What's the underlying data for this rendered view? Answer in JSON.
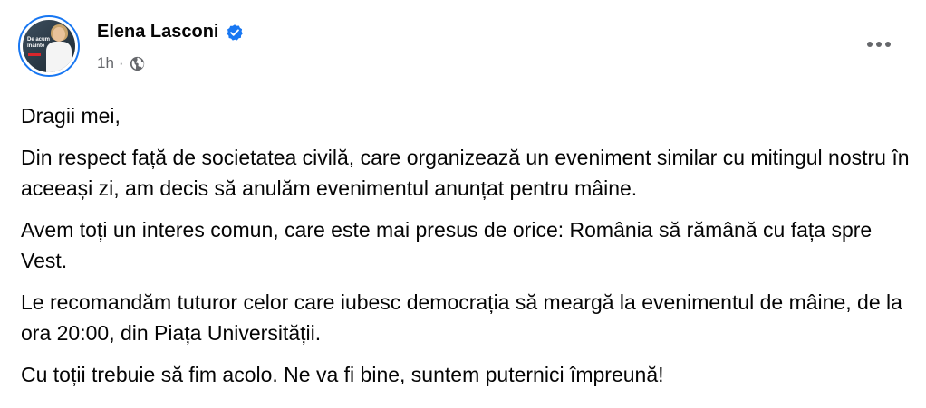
{
  "post": {
    "author": {
      "name": "Elena Lasconi",
      "verified": true,
      "avatar_caption": "De acum înainte"
    },
    "meta": {
      "time": "1h",
      "separator": "·",
      "audience_icon": "globe-icon"
    },
    "more_icon": "more-horizontal-icon",
    "paragraphs": [
      "Dragii mei,",
      "Din respect față de societatea civilă, care organizează un eveniment similar cu mitingul nostru în aceeași zi, am decis să anulăm evenimentul anunțat pentru mâine.",
      "Avem toți un interes comun, care este mai presus de orice: România să rămână cu fața spre Vest.",
      "Le recomandăm tuturor celor care iubesc democrația să meargă la evenimentul de mâine, de la ora 20:00, din Piața Universității.",
      "Cu toții trebuie să fim acolo. Ne va fi bine, suntem puternici împreună!"
    ]
  },
  "colors": {
    "verified_blue": "#1877f2",
    "meta_gray": "#65676b",
    "text": "#050505"
  }
}
